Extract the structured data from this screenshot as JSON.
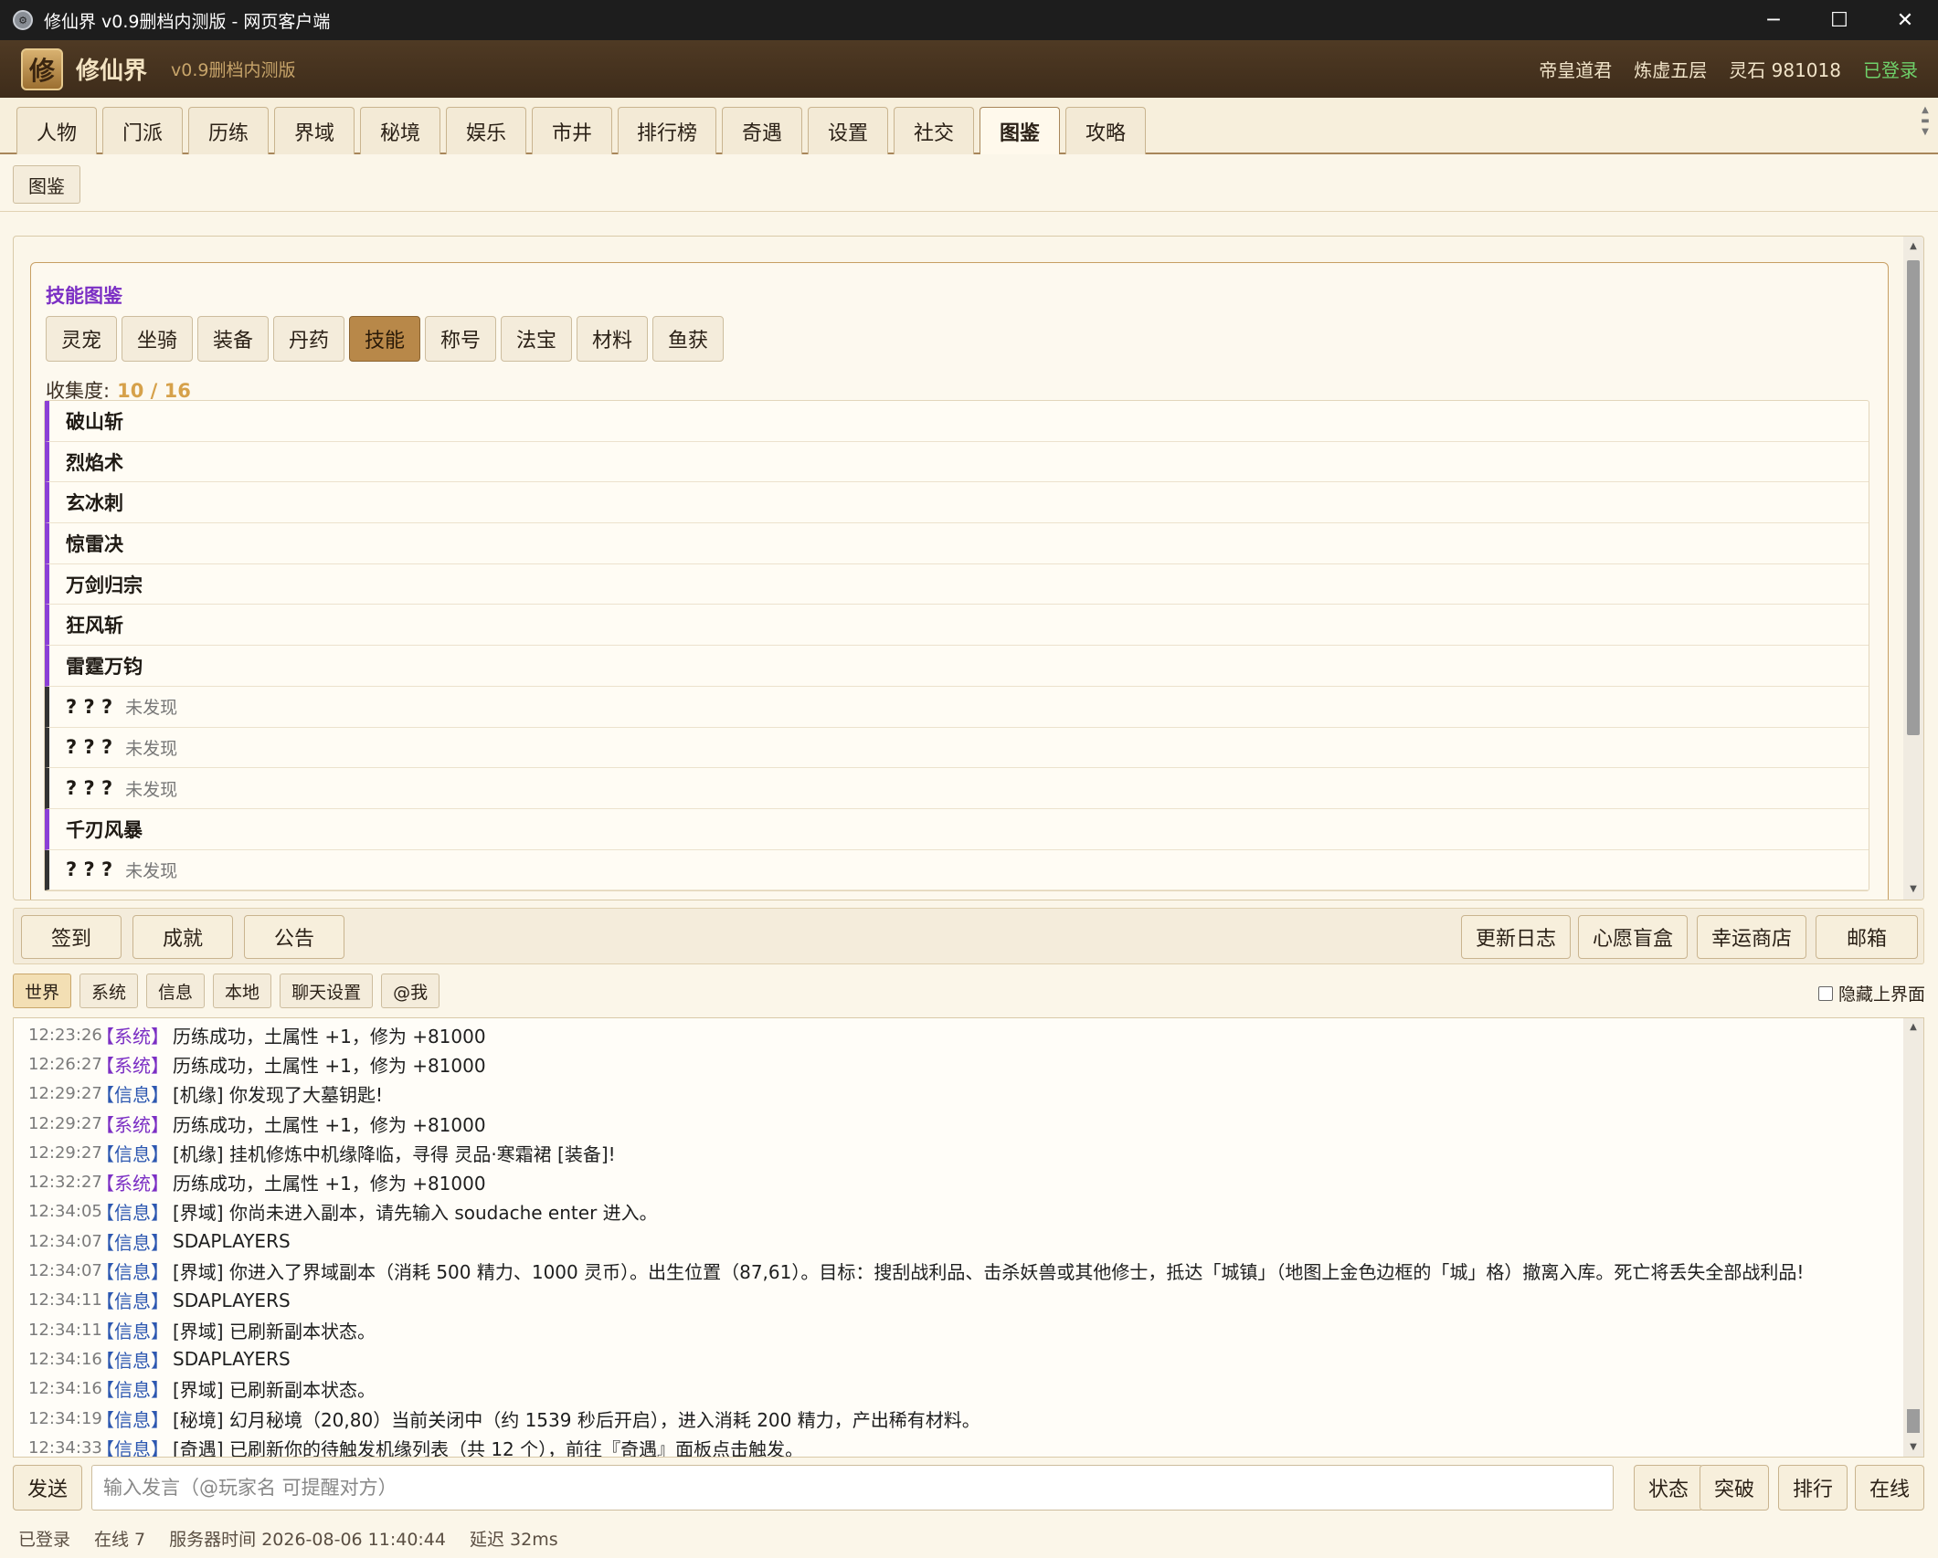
{
  "window": {
    "title": "修仙界 v0.9删档内测版 - 网页客户端",
    "minimize": "─",
    "maximize": "☐",
    "close": "✕"
  },
  "header": {
    "logo_char": "修",
    "brand": "修仙界",
    "version": "v0.9删档内测版",
    "player_name": "帝皇道君",
    "realm": "炼虚五层",
    "spirit_stones": "灵石 981018",
    "login_status": "已登录"
  },
  "nav": {
    "tabs": [
      "人物",
      "门派",
      "历练",
      "界域",
      "秘境",
      "娱乐",
      "市井",
      "排行榜",
      "奇遇",
      "设置",
      "社交",
      "图鉴",
      "攻略"
    ],
    "active": "图鉴"
  },
  "subnav": {
    "tab": "图鉴"
  },
  "codex": {
    "title": "技能图鉴",
    "categories": [
      "灵宠",
      "坐骑",
      "装备",
      "丹药",
      "技能",
      "称号",
      "法宝",
      "材料",
      "鱼获"
    ],
    "active_category": "技能",
    "collect_label": "收集度:",
    "collect_value": "10 / 16",
    "items": [
      {
        "name": "破山斩",
        "status": ""
      },
      {
        "name": "烈焰术",
        "status": ""
      },
      {
        "name": "玄冰刺",
        "status": ""
      },
      {
        "name": "惊雷决",
        "status": ""
      },
      {
        "name": "万剑归宗",
        "status": ""
      },
      {
        "name": "狂风斩",
        "status": ""
      },
      {
        "name": "雷霆万钧",
        "status": ""
      },
      {
        "name": "? ? ?",
        "status": "未发现"
      },
      {
        "name": "? ? ?",
        "status": "未发现"
      },
      {
        "name": "? ? ?",
        "status": "未发现"
      },
      {
        "name": "千刃风暴",
        "status": ""
      },
      {
        "name": "? ? ?",
        "status": "未发现"
      }
    ]
  },
  "actions": {
    "checkin": "签到",
    "achievements": "成就",
    "announcement": "公告",
    "changelog": "更新日志",
    "wish_box": "心愿盲盒",
    "lucky_shop": "幸运商店",
    "mailbox": "邮箱"
  },
  "chat": {
    "tabs": [
      "世界",
      "系统",
      "信息",
      "本地",
      "聊天设置",
      "@我"
    ],
    "active_tab": "世界",
    "hide_ui_label": "隐藏上界面",
    "lines": [
      {
        "time": "12:23:26",
        "tag": "【系统】",
        "kind": "sys",
        "msg": "历练成功，土属性 +1，修为 +81000"
      },
      {
        "time": "12:26:27",
        "tag": "【系统】",
        "kind": "sys",
        "msg": "历练成功，土属性 +1，修为 +81000"
      },
      {
        "time": "12:29:27",
        "tag": "【信息】",
        "kind": "info",
        "msg": "[机缘] 你发现了大墓钥匙!"
      },
      {
        "time": "12:29:27",
        "tag": "【系统】",
        "kind": "sys",
        "msg": "历练成功，土属性 +1，修为 +81000"
      },
      {
        "time": "12:29:27",
        "tag": "【信息】",
        "kind": "info",
        "msg": "[机缘] 挂机修炼中机缘降临，寻得 灵品·寒霜裙 [装备]!"
      },
      {
        "time": "12:32:27",
        "tag": "【系统】",
        "kind": "sys",
        "msg": "历练成功，土属性 +1，修为 +81000"
      },
      {
        "time": "12:34:05",
        "tag": "【信息】",
        "kind": "info",
        "msg": "[界域] 你尚未进入副本，请先输入 soudache enter 进入。"
      },
      {
        "time": "12:34:07",
        "tag": "【信息】",
        "kind": "info",
        "msg": "SDAPLAYERS"
      },
      {
        "time": "12:34:07",
        "tag": "【信息】",
        "kind": "info",
        "msg": "[界域] 你进入了界域副本（消耗 500 精力、1000 灵币）。出生位置（87,61）。目标：搜刮战利品、击杀妖兽或其他修士，抵达「城镇」（地图上金色边框的「城」格）撤离入库。死亡将丢失全部战利品!"
      },
      {
        "time": "12:34:11",
        "tag": "【信息】",
        "kind": "info",
        "msg": "SDAPLAYERS"
      },
      {
        "time": "12:34:11",
        "tag": "【信息】",
        "kind": "info",
        "msg": "[界域] 已刷新副本状态。"
      },
      {
        "time": "12:34:16",
        "tag": "【信息】",
        "kind": "info",
        "msg": "SDAPLAYERS"
      },
      {
        "time": "12:34:16",
        "tag": "【信息】",
        "kind": "info",
        "msg": "[界域] 已刷新副本状态。"
      },
      {
        "time": "12:34:19",
        "tag": "【信息】",
        "kind": "info",
        "msg": "[秘境] 幻月秘境（20,80）当前关闭中（约 1539 秒后开启），进入消耗 200 精力，产出稀有材料。"
      },
      {
        "time": "12:34:33",
        "tag": "【信息】",
        "kind": "info",
        "msg": "[奇遇] 已刷新你的待触发机缘列表（共 12 个），前往『奇遇』面板点击触发。"
      }
    ]
  },
  "input": {
    "send": "发送",
    "placeholder": "输入发言（@玩家名 可提醒对方）",
    "value": ""
  },
  "quick": {
    "status": "状态",
    "breakthrough": "突破",
    "ranking": "排行",
    "online": "在线"
  },
  "statusbar": {
    "login": "已登录",
    "online_count": "在线 7",
    "server_time": "服务器时间 2026-08-06 11:40:44",
    "latency": "延迟 32ms"
  }
}
